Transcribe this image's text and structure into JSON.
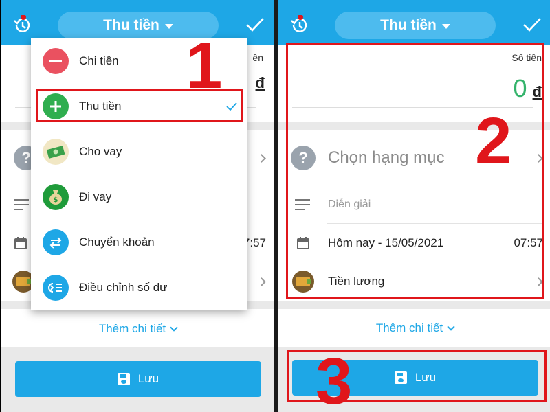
{
  "header": {
    "title": "Thu tiền"
  },
  "amount": {
    "label": "Số tiền",
    "value": "0",
    "unit": "đ"
  },
  "left_peek": {
    "amount_label_tail": "ền",
    "time_tail": "07:57"
  },
  "menu": {
    "items": [
      {
        "label": "Chi tiền",
        "icon": "minus-icon",
        "color": "#ea5160"
      },
      {
        "label": "Thu tiền",
        "icon": "plus-icon",
        "color": "#2fae4f",
        "selected": true
      },
      {
        "label": "Cho vay",
        "icon": "money-icon",
        "color": "#f1e7c4"
      },
      {
        "label": "Đi vay",
        "icon": "money-bag-icon",
        "color": "#1f9b3a"
      },
      {
        "label": "Chuyển khoản",
        "icon": "transfer-icon",
        "color": "#1ea7e6"
      },
      {
        "label": "Điều chỉnh số dư",
        "icon": "adjust-balance-icon",
        "color": "#1ea7e6"
      }
    ]
  },
  "form": {
    "category_placeholder": "Chọn hạng mục",
    "description_placeholder": "Diễn giải",
    "date": "Hôm nay - 15/05/2021",
    "time": "07:57",
    "wallet": "Tiền lương"
  },
  "more_details": "Thêm chi tiết",
  "save_label": "Lưu",
  "annotations": {
    "step1": "1",
    "step2": "2",
    "step3": "3"
  },
  "colors": {
    "primary": "#1ea7e6",
    "annotation": "#e0161b",
    "amount": "#34b36b"
  }
}
